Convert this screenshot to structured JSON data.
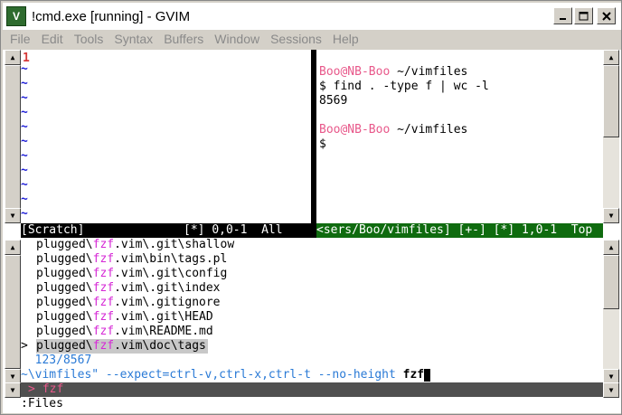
{
  "window": {
    "title": "!cmd.exe [running] - GVIM",
    "icon_label": "V"
  },
  "menu": [
    "File",
    "Edit",
    "Tools",
    "Syntax",
    "Buffers",
    "Window",
    "Sessions",
    "Help"
  ],
  "left_pane": {
    "line_number": "1",
    "tilde": "~",
    "status": "[Scratch]              [*] 0,0-1  All"
  },
  "terminal": {
    "prompt_user": "Boo@NB-Boo",
    "prompt_dir": " ~/vimfiles",
    "command": "$ find . -type f | wc -l",
    "output": "8569",
    "cursor_line": "$",
    "status": "<sers/Boo/vimfiles] [+-] [*] 1,0-1  Top"
  },
  "fzf": {
    "results": [
      {
        "pre": "plugged\\",
        "match": "fzf",
        "post": ".vim\\.git\\shallow"
      },
      {
        "pre": "plugged\\",
        "match": "fzf",
        "post": ".vim\\bin\\tags.pl"
      },
      {
        "pre": "plugged\\",
        "match": "fzf",
        "post": ".vim\\.git\\config"
      },
      {
        "pre": "plugged\\",
        "match": "fzf",
        "post": ".vim\\.git\\index"
      },
      {
        "pre": "plugged\\",
        "match": "fzf",
        "post": ".vim\\.gitignore"
      },
      {
        "pre": "plugged\\",
        "match": "fzf",
        "post": ".vim\\.git\\HEAD"
      },
      {
        "pre": "plugged\\",
        "match": "fzf",
        "post": ".vim\\README.md"
      },
      {
        "pre": "plugged\\",
        "match": "fzf",
        "post": ".vim\\doc\\tags"
      }
    ],
    "selected_marker": ">",
    "count": "  123/8567",
    "cmdline": "~\\vimfiles\" --expect=ctrl-v,ctrl-x,ctrl-t --no-height ",
    "cmdline_query": "fzf",
    "prompt_marker": ">",
    "prompt_query": "fzf"
  },
  "command_line": ":Files",
  "colors": {
    "status_black": "#000000",
    "status_green": "#0f6b0f",
    "fzf_match": "#d629d6",
    "prompt_pink": "#e8588a"
  }
}
